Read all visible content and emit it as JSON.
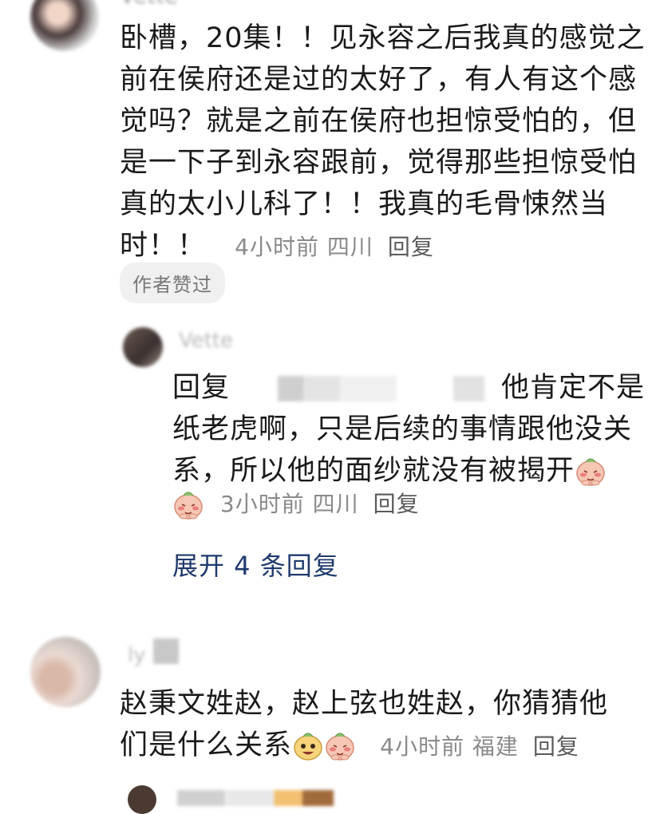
{
  "comments": [
    {
      "username": "Vette",
      "text": "卧槽，20集！！见永容之后我真的感觉之前在侯府还是过的太好了，有人有这个感觉吗？就是之前在侯府也担惊受怕的，但是一下子到永容跟前，觉得那些担惊受怕真的太小儿科了！！我真的毛骨悚然当时！！",
      "time": "4小时前",
      "location": "四川",
      "reply_label": "回复",
      "badge": "作者赞过"
    },
    {
      "username": "Vette",
      "text_prefix": "回复",
      "text": "他肯定不是纸老虎啊，只是后续的事情跟他没关系，所以他的面纱就没有被揭开",
      "time": "3小时前",
      "location": "四川",
      "reply_label": "回复",
      "emojis": [
        "shy-emoji",
        "shy-emoji"
      ]
    },
    {
      "username": "ly",
      "text": "赵秉文姓赵，赵上弦也姓赵，你猜猜他们是什么关系",
      "time": "4小时前",
      "location": "福建",
      "reply_label": "回复",
      "emojis": [
        "grin-emoji",
        "shy-emoji"
      ]
    }
  ],
  "expand_replies": "展开 4 条回复",
  "colors": {
    "text": "#1a1a1a",
    "meta": "#8a8a8a",
    "link": "#1f3a6e",
    "badge_bg": "#f0f0f0"
  }
}
